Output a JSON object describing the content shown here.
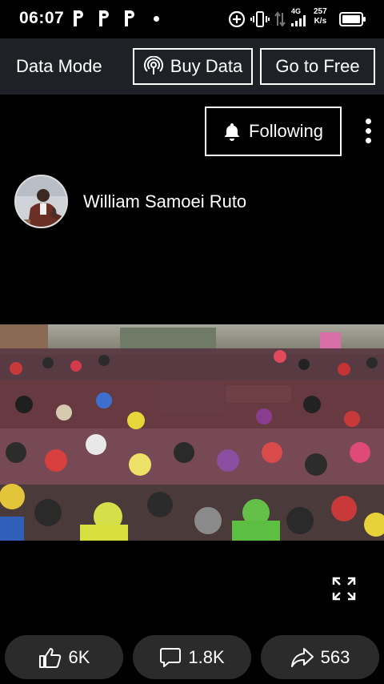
{
  "status_bar": {
    "time": "06:07",
    "app_icons": [
      "p-app-icon",
      "p-app-icon",
      "p-app-icon"
    ],
    "network_type": "4G",
    "speed_value": "257",
    "speed_unit": "K/s"
  },
  "data_bar": {
    "title": "Data Mode",
    "buy_label": "Buy Data",
    "free_label": "Go to Free"
  },
  "post": {
    "follow_label": "Following",
    "author_name": "William Samoei Ruto"
  },
  "actions": {
    "likes": "6K",
    "comments": "1.8K",
    "shares": "563"
  },
  "colors": {
    "background": "#000000",
    "data_bar": "#1e2126",
    "action_pill": "#2b2b2b",
    "text": "#ffffff"
  }
}
